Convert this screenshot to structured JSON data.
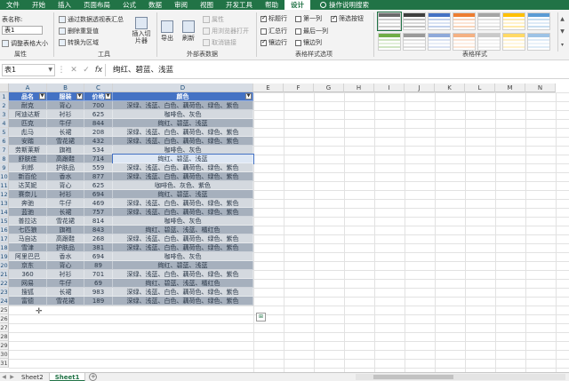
{
  "tabs": [
    "文件",
    "开始",
    "插入",
    "页面布局",
    "公式",
    "数据",
    "审阅",
    "视图",
    "开发工具",
    "帮助",
    "设计"
  ],
  "active_tab": "设计",
  "search_label": "操作说明搜索",
  "ribbon": {
    "properties": {
      "table_name_label": "表名称:",
      "table_name_value": "表1",
      "resize_label": "调整表格大小",
      "group_label": "属性"
    },
    "tools": {
      "pivot_label": "通过数据透视表汇总",
      "remove_dup_label": "删除重复值",
      "convert_label": "转换为区域",
      "slicer_label": "插入切片器",
      "group_label": "工具"
    },
    "external": {
      "export_label": "导出",
      "refresh_label": "刷新",
      "properties_label": "属性",
      "open_browser_label": "用浏览器打开",
      "unlink_label": "取消链接",
      "group_label": "外部表数据"
    },
    "style_options": {
      "header_row": "标题行",
      "total_row": "汇总行",
      "banded_rows": "镶边行",
      "first_column": "第一列",
      "last_column": "最后一列",
      "banded_columns": "镶边列",
      "filter_button": "筛选按钮",
      "group_label": "表格样式选项"
    },
    "styles": {
      "group_label": "表格样式"
    }
  },
  "formula_bar": {
    "name_box": "表1",
    "formula": "绚红、碧蓝、浅蓝"
  },
  "columns": [
    "A",
    "B",
    "C",
    "D",
    "E",
    "F",
    "G",
    "H",
    "I",
    "J",
    "K",
    "L",
    "M",
    "N"
  ],
  "rows": [
    "1",
    "2",
    "3",
    "4",
    "5",
    "6",
    "7",
    "8",
    "9",
    "10",
    "11",
    "12",
    "13",
    "14",
    "15",
    "16",
    "17",
    "18",
    "19",
    "20",
    "21",
    "22",
    "23",
    "24",
    "25",
    "26",
    "27",
    "28",
    "29",
    "30",
    "31"
  ],
  "table": {
    "headers": [
      "品名",
      "服装",
      "价格",
      "颜色"
    ],
    "data": [
      [
        "耐克",
        "背心",
        "700",
        "深绿、浅蓝、白色、藕荷色、绿色、紫色"
      ],
      [
        "阿迪达斯",
        "衬衫",
        "625",
        "咖啡色、灰色"
      ],
      [
        "匹克",
        "牛仔",
        "844",
        "绚红、碧蓝、浅蓝"
      ],
      [
        "彪马",
        "长裙",
        "208",
        "深绿、浅蓝、白色、藕荷色、绿色、紫色"
      ],
      [
        "安踏",
        "雪花裙",
        "432",
        "深绿、浅蓝、白色、藕荷色、绿色、紫色"
      ],
      [
        "劳斯莱斯",
        "旗袍",
        "534",
        "咖啡色、灰色"
      ],
      [
        "舒肤佳",
        "高跟鞋",
        "714",
        "绚红、碧蓝、浅蓝"
      ],
      [
        "利郎",
        "护肤品",
        "559",
        "深绿、浅蓝、白色、藕荷色、绿色、紫色"
      ],
      [
        "新百伦",
        "香水",
        "877",
        "深绿、浅蓝、白色、藕荷色、绿色、紫色"
      ],
      [
        "达芙妮",
        "背心",
        "625",
        "咖啡色、灰色、紫色"
      ],
      [
        "赛奈儿",
        "衬衫",
        "694",
        "绚红、碧蓝、浅蓝"
      ],
      [
        "奔驰",
        "牛仔",
        "469",
        "深绿、浅蓝、白色、藕荷色、绿色、紫色"
      ],
      [
        "蓝驰",
        "长裙",
        "757",
        "深绿、浅蓝、白色、藕荷色、绿色、紫色"
      ],
      [
        "普拉达",
        "雪花裙",
        "814",
        "咖啡色、灰色"
      ],
      [
        "七匹狼",
        "旗袍",
        "843",
        "绚红、碧蓝、浅蓝、橘红色"
      ],
      [
        "马自达",
        "高跟鞋",
        "268",
        "深绿、浅蓝、白色、藕荷色、绿色、紫色"
      ],
      [
        "雪津",
        "护肤品",
        "381",
        "深绿、浅蓝、白色、藕荷色、绿色、紫色"
      ],
      [
        "阿里巴巴",
        "香水",
        "694",
        "咖啡色、灰色"
      ],
      [
        "京东",
        "背心",
        "89",
        "绚红、碧蓝、浅蓝"
      ],
      [
        "360",
        "衬衫",
        "701",
        "深绿、浅蓝、白色、藕荷色、绿色、紫色"
      ],
      [
        "网易",
        "牛仔",
        "69",
        "绚红、碧蓝、浅蓝、橘红色"
      ],
      [
        "搜狐",
        "长裙",
        "983",
        "深绿、浅蓝、白色、藕荷色、绿色、紫色"
      ],
      [
        "富德",
        "雪花裙",
        "189",
        "深绿、浅蓝、白色、藕荷色、绿色、紫色"
      ]
    ]
  },
  "sheets": [
    "Sheet2",
    "Sheet1"
  ],
  "active_sheet": "Sheet1",
  "colors": {
    "accent": "#217346",
    "table_header": "#4472c4",
    "band_dark": "#a6b0bd",
    "band_light": "#d4d9df"
  }
}
